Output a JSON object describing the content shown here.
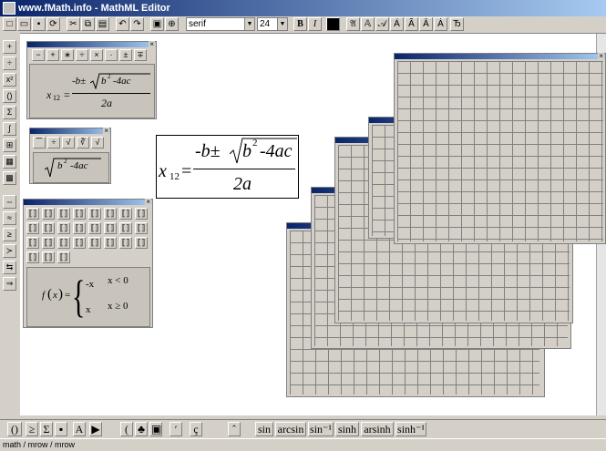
{
  "window": {
    "title": "www.fMath.info - MathML Editor"
  },
  "toolbar": {
    "font_family": "serif",
    "font_size": "24",
    "bold": "B",
    "italic": "I"
  },
  "formula": {
    "lhs": "x",
    "lhs_sub": "12",
    "equals": "=",
    "numerator_pre": "-b±",
    "radicand": "b",
    "radicand_exp": "2",
    "radicand_rest": "-4ac",
    "denominator": "2a"
  },
  "palettes": {
    "operators": [
      "−",
      "+",
      "∗",
      "÷",
      "×",
      "·",
      "±",
      "∓"
    ],
    "piecewise": {
      "f": "f",
      "x": "x",
      "row1_val": "-x",
      "row1_cond": "x < 0",
      "row2_val": "x",
      "row2_cond": "x ≥ 0"
    }
  },
  "functions": [
    "sin",
    "arcsin",
    "sin⁻¹",
    "sinh",
    "arsinh",
    "sinh⁻¹"
  ],
  "status": "math / mrow / mrow"
}
